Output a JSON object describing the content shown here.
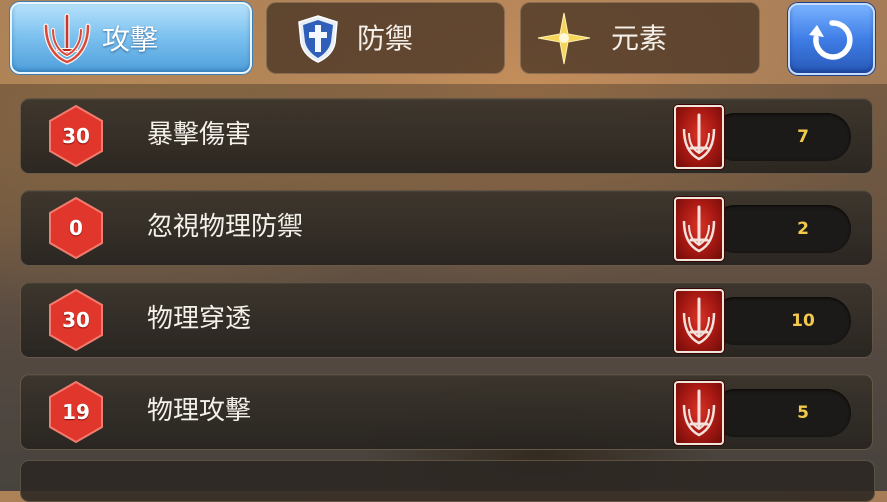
{
  "tabs": [
    {
      "label": "攻擊",
      "icon": "crossed-swords-icon",
      "active": true
    },
    {
      "label": "防禦",
      "icon": "cross-shield-icon",
      "active": false
    },
    {
      "label": "元素",
      "icon": "gold-star-icon",
      "active": false
    }
  ],
  "refresh": {
    "icon": "refresh-icon"
  },
  "stats": [
    {
      "badge": "30",
      "name": "暴擊傷害",
      "value": "7",
      "icon": "sword-card-icon"
    },
    {
      "badge": "0",
      "name": "忽視物理防禦",
      "value": "2",
      "icon": "sword-card-icon"
    },
    {
      "badge": "30",
      "name": "物理穿透",
      "value": "10",
      "icon": "sword-card-icon"
    },
    {
      "badge": "19",
      "name": "物理攻擊",
      "value": "5",
      "icon": "sword-card-icon"
    }
  ],
  "colors": {
    "active_tab": "#7cc1ef",
    "refresh_button": "#3f7ee6",
    "badge": "#e0362b",
    "value_text": "#f2c84d"
  }
}
